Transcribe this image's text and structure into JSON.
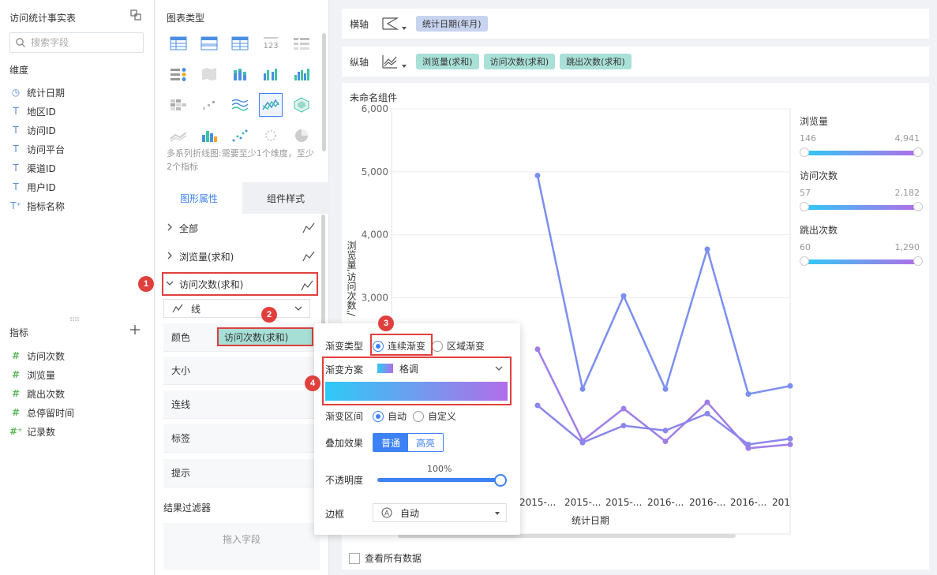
{
  "left_panel": {
    "table_name": "访问统计事实表",
    "search_placeholder": "搜索字段",
    "dimension_title": "维度",
    "dimensions": [
      {
        "icon": "clock-icon",
        "label": "统计日期"
      },
      {
        "icon": "text-type-icon",
        "label": "地区ID"
      },
      {
        "icon": "text-type-icon",
        "label": "访问ID"
      },
      {
        "icon": "text-type-icon",
        "label": "访问平台"
      },
      {
        "icon": "text-type-icon",
        "label": "渠道ID"
      },
      {
        "icon": "text-type-icon",
        "label": "用户ID"
      },
      {
        "icon": "text-type-icon",
        "label": "指标名称"
      }
    ],
    "measure_title": "指标",
    "measures": [
      {
        "label": "访问次数"
      },
      {
        "label": "浏览量"
      },
      {
        "label": "跳出次数"
      },
      {
        "label": "总停留时间"
      },
      {
        "label": "记录数"
      }
    ]
  },
  "middle_panel": {
    "chart_type_title": "图表类型",
    "chart_hint": "多系列折线图:需要至少1个维度，至少2个指标",
    "tabs": [
      "图形属性",
      "组件样式"
    ],
    "props": {
      "all": "全部",
      "views": "浏览量(求和)",
      "visits": "访问次数(求和)"
    },
    "line_type": "线",
    "options": {
      "color": "颜色",
      "color_field": "访问次数(求和)",
      "size": "大小",
      "connect": "连线",
      "label": "标签",
      "tooltip": "提示"
    },
    "result_filter": "结果过滤器",
    "drop_hint": "拖入字段"
  },
  "axes": {
    "x_label": "横轴",
    "x_field": "统计日期(年月)",
    "y_label": "纵轴",
    "y_fields": [
      "浏览量(求和)",
      "访问次数(求和)",
      "跳出次数(求和)"
    ]
  },
  "widget": {
    "title": "未命名组件",
    "view_all": "查看所有数据"
  },
  "legend": [
    {
      "name": "浏览量",
      "min": "146",
      "max": "4,941"
    },
    {
      "name": "访问次数",
      "min": "57",
      "max": "2,182"
    },
    {
      "name": "跳出次数",
      "min": "60",
      "max": "1,290"
    }
  ],
  "popup": {
    "gradient_type": "渐变类型",
    "continuous": "连续渐变",
    "region": "区域渐变",
    "scheme": "渐变方案",
    "scheme_value": "格调",
    "interval": "渐变区间",
    "auto": "自动",
    "custom": "自定义",
    "overlay": "叠加效果",
    "normal": "普通",
    "highlight": "高亮",
    "opacity_label": "不透明度",
    "opacity_value": "100%",
    "border_label": "边框",
    "border_value": "自动"
  },
  "badges": [
    "1",
    "2",
    "3",
    "4"
  ],
  "colors": {
    "accent": "#3d82f5",
    "highlight_red": "#e0403d",
    "gradient_start": "#2dcaf6",
    "gradient_end": "#b16ee8"
  },
  "chart_data": {
    "type": "line",
    "xlabel": "统计日期",
    "ylabel": "浏览量,访问次数,/",
    "ylim": [
      0,
      6000
    ],
    "yticks": [
      "6,000",
      "5,000",
      "4,000",
      "3,000"
    ],
    "x_tick_labels": [
      "2015-...",
      "2015-...",
      "2015-...",
      "2016-...",
      "2016-...",
      "2016-...",
      "201"
    ],
    "series": [
      {
        "name": "浏览量",
        "values": [
          4941,
          1550,
          3030,
          1550,
          3770,
          1470,
          1600
        ]
      },
      {
        "name": "访问次数",
        "values": [
          2182,
          730,
          1240,
          720,
          1340,
          610,
          670
        ]
      },
      {
        "name": "跳出次数",
        "values": [
          1290,
          700,
          970,
          890,
          1160,
          670,
          760
        ]
      }
    ]
  }
}
